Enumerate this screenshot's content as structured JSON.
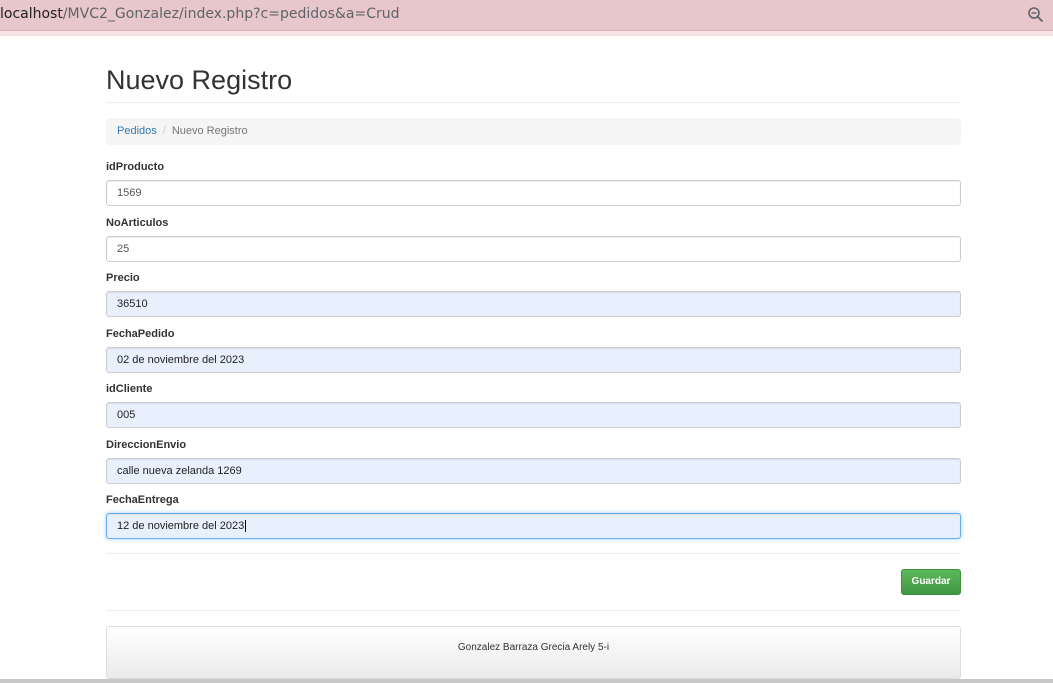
{
  "browser": {
    "url_host": "localhost",
    "url_path": "/MVC2_Gonzalez/index.php?c=pedidos&a=Crud"
  },
  "page": {
    "title": "Nuevo Registro",
    "breadcrumb": {
      "link": "Pedidos",
      "current": "Nuevo Registro"
    }
  },
  "form": {
    "fields": [
      {
        "label": "idProducto",
        "value": "1569"
      },
      {
        "label": "NoArticulos",
        "value": "25"
      },
      {
        "label": "Precio",
        "value": "36510"
      },
      {
        "label": "FechaPedido",
        "value": "02 de noviembre del 2023"
      },
      {
        "label": "idCliente",
        "value": "005"
      },
      {
        "label": "DireccionEnvio",
        "value": "calle nueva zelanda 1269"
      },
      {
        "label": "FechaEntrega",
        "value": "12 de noviembre del 2023"
      }
    ],
    "save_label": "Guardar"
  },
  "footer": {
    "text": "Gonzalez Barraza Grecia Arely 5-i"
  },
  "colors": {
    "accent": "#5cb85c",
    "link": "#337ab7",
    "autofill": "#e8f0fe",
    "urlbar": "#e8c7cc"
  },
  "icons": {
    "zoom": "magnifier-icon"
  }
}
